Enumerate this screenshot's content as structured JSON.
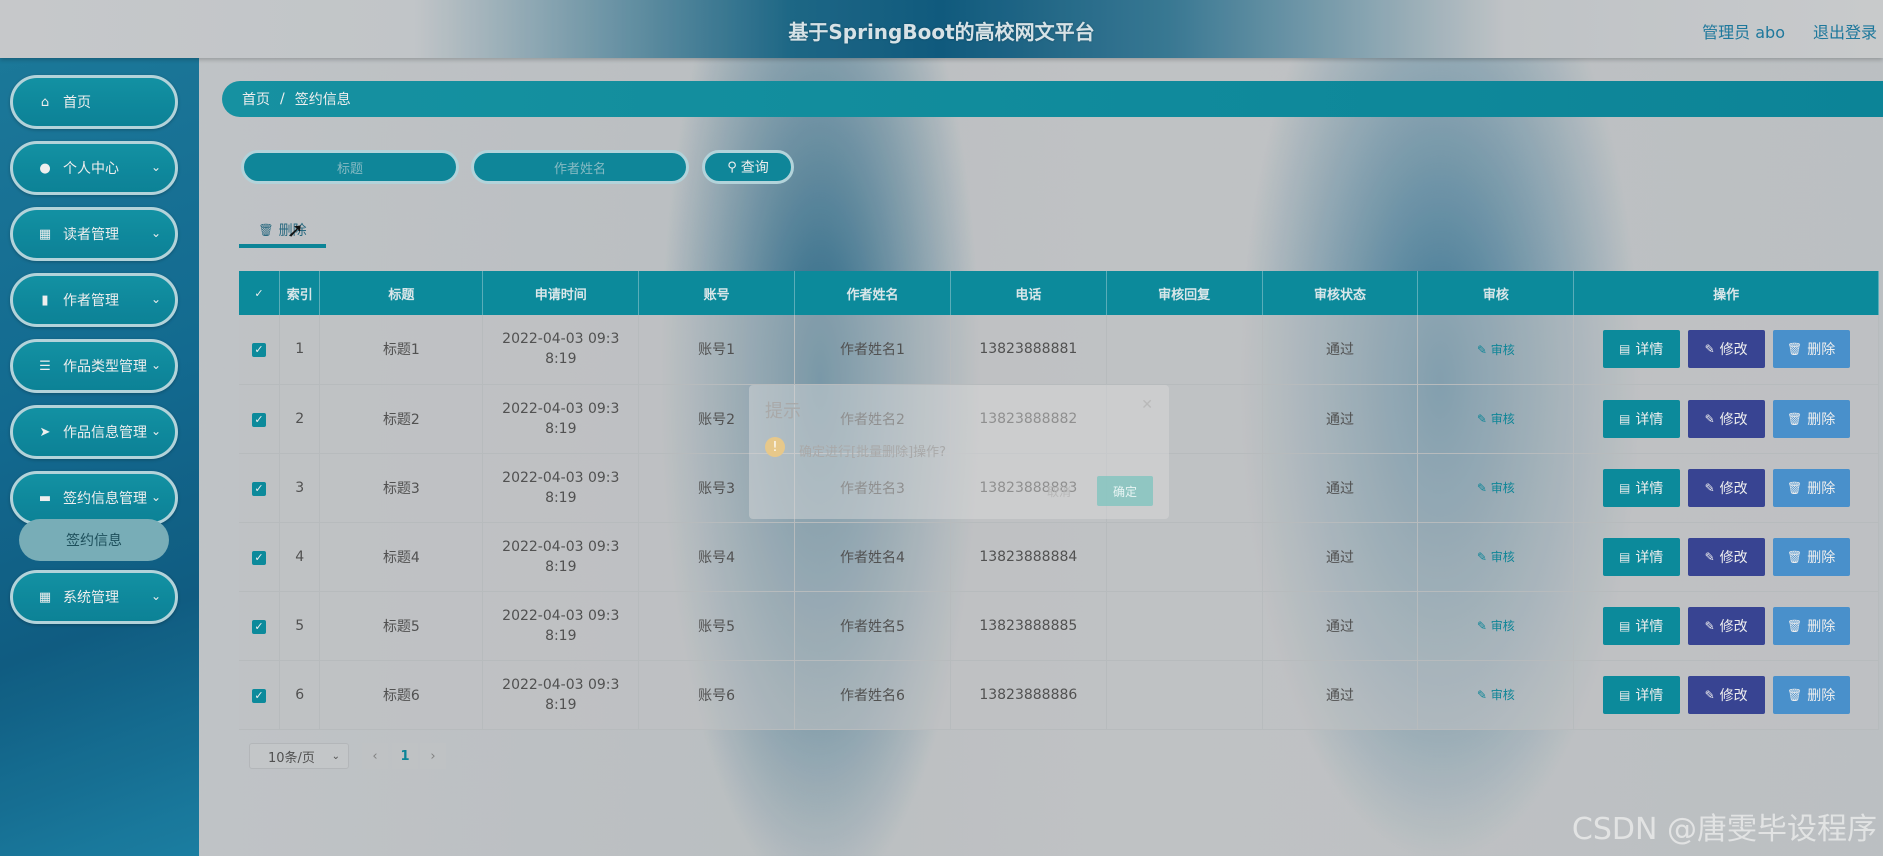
{
  "header": {
    "title": "基于SpringBoot的高校网文平台",
    "user": "管理员 abo",
    "logout": "退出登录"
  },
  "sidebar": {
    "items": [
      {
        "label": "首页",
        "icon": "home-icon",
        "glyph": "⌂"
      },
      {
        "label": "个人中心",
        "icon": "user-icon",
        "glyph": "●",
        "arrow": "⌄"
      },
      {
        "label": "读者管理",
        "icon": "grid-icon",
        "glyph": "▦",
        "arrow": "⌄"
      },
      {
        "label": "作者管理",
        "icon": "book-icon",
        "glyph": "▮",
        "arrow": "⌄"
      },
      {
        "label": "作品类型管理",
        "icon": "sliders-icon",
        "glyph": "☰",
        "arrow": "⌄"
      },
      {
        "label": "作品信息管理",
        "icon": "send-icon",
        "glyph": "➤",
        "arrow": "⌄"
      },
      {
        "label": "签约信息管理",
        "icon": "monitor-icon",
        "glyph": "▬",
        "arrow": "⌄"
      },
      {
        "label": "系统管理",
        "icon": "grid-icon",
        "glyph": "▦",
        "arrow": "⌄"
      }
    ],
    "sub_item": "签约信息"
  },
  "breadcrumb": {
    "home": "首页",
    "separator": "/",
    "current": "签约信息"
  },
  "search": {
    "title_placeholder": "标题",
    "author_placeholder": "作者姓名",
    "button": "查询",
    "button_icon": "search-icon"
  },
  "toolbar": {
    "batch_delete": "删除",
    "batch_delete_icon": "trash-icon"
  },
  "table": {
    "columns": [
      "",
      "索引",
      "标题",
      "申请时间",
      "账号",
      "作者姓名",
      "电话",
      "审核回复",
      "审核状态",
      "审核",
      "操作"
    ],
    "rows": [
      {
        "index": "1",
        "title": "标题1",
        "time": "2022-04-03 09:38:19",
        "account": "账号1",
        "author": "作者姓名1",
        "phone": "13823888881",
        "reply": "",
        "status": "通过"
      },
      {
        "index": "2",
        "title": "标题2",
        "time": "2022-04-03 09:38:19",
        "account": "账号2",
        "author": "作者姓名2",
        "phone": "13823888882",
        "reply": "",
        "status": "通过"
      },
      {
        "index": "3",
        "title": "标题3",
        "time": "2022-04-03 09:38:19",
        "account": "账号3",
        "author": "作者姓名3",
        "phone": "13823888883",
        "reply": "",
        "status": "通过"
      },
      {
        "index": "4",
        "title": "标题4",
        "time": "2022-04-03 09:38:19",
        "account": "账号4",
        "author": "作者姓名4",
        "phone": "13823888884",
        "reply": "",
        "status": "通过"
      },
      {
        "index": "5",
        "title": "标题5",
        "time": "2022-04-03 09:38:19",
        "account": "账号5",
        "author": "作者姓名5",
        "phone": "13823888885",
        "reply": "",
        "status": "通过"
      },
      {
        "index": "6",
        "title": "标题6",
        "time": "2022-04-03 09:38:19",
        "account": "账号6",
        "author": "作者姓名6",
        "phone": "13823888886",
        "reply": "",
        "status": "通过"
      }
    ],
    "audit_label": "审核",
    "detail_label": "详情",
    "edit_label": "修改",
    "delete_label": "删除"
  },
  "pagination": {
    "page_size": "10条/页",
    "current_page": "1"
  },
  "dialog": {
    "title": "提示",
    "message": "确定进行[批量删除]操作?",
    "cancel": "取消",
    "confirm": "确定"
  },
  "watermark": "CSDN @唐雯毕设程序",
  "colors": {
    "accent": "#0a93a5",
    "edit": "#3a479c",
    "delete": "#4c99d9",
    "link": "#1d7fa6"
  }
}
